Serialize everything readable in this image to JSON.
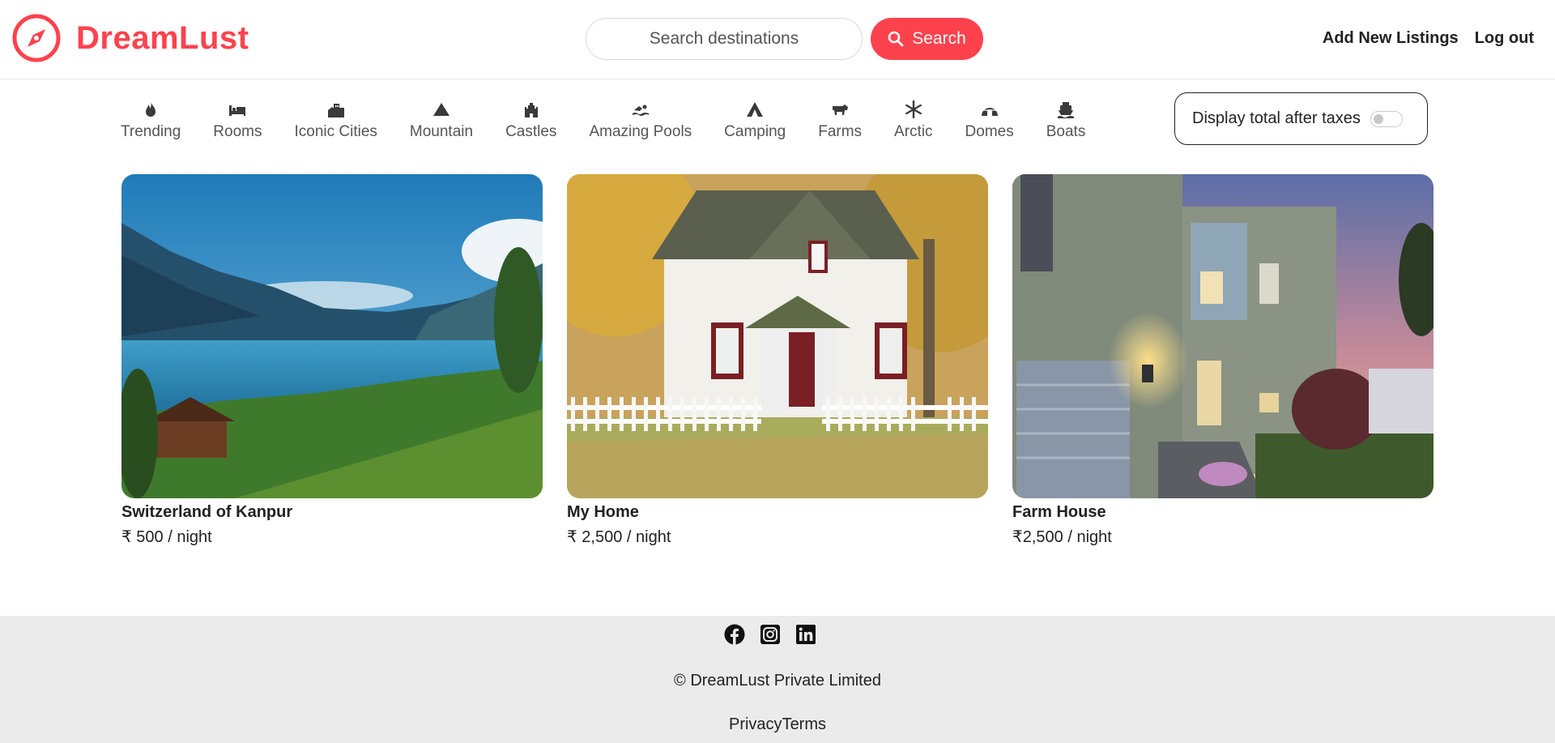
{
  "brand": {
    "name": "DreamLust",
    "color": "#fe424d",
    "icon": "compass-icon"
  },
  "search": {
    "placeholder": "Search destinations",
    "button_label": "Search",
    "icon": "search-icon"
  },
  "nav": {
    "add_listing": "Add New Listings",
    "logout": "Log out"
  },
  "filters": [
    {
      "label": "Trending",
      "icon": "fire-icon"
    },
    {
      "label": "Rooms",
      "icon": "bed-icon"
    },
    {
      "label": "Iconic Cities",
      "icon": "city-icon"
    },
    {
      "label": "Mountain",
      "icon": "mountain-icon"
    },
    {
      "label": "Castles",
      "icon": "castle-icon"
    },
    {
      "label": "Amazing Pools",
      "icon": "swimmer-icon"
    },
    {
      "label": "Camping",
      "icon": "tent-icon"
    },
    {
      "label": "Farms",
      "icon": "cow-icon"
    },
    {
      "label": "Arctic",
      "icon": "snowflake-icon"
    },
    {
      "label": "Domes",
      "icon": "igloo-icon"
    },
    {
      "label": "Boats",
      "icon": "ship-icon"
    }
  ],
  "tax_toggle": {
    "label": "Display total after taxes",
    "enabled": false
  },
  "listings": [
    {
      "title": "Switzerland of Kanpur",
      "price": "₹ 500 / night",
      "image": "lake-mountain-landscape"
    },
    {
      "title": "My Home",
      "price": "₹ 2,500 / night",
      "image": "white-house-autumn"
    },
    {
      "title": "Farm House",
      "price": "₹2,500 / night",
      "image": "modern-house-dusk"
    }
  ],
  "footer": {
    "socials": [
      "facebook-icon",
      "instagram-icon",
      "linkedin-icon"
    ],
    "copyright": "© DreamLust Private Limited",
    "privacy": "Privacy",
    "terms": "Terms"
  }
}
